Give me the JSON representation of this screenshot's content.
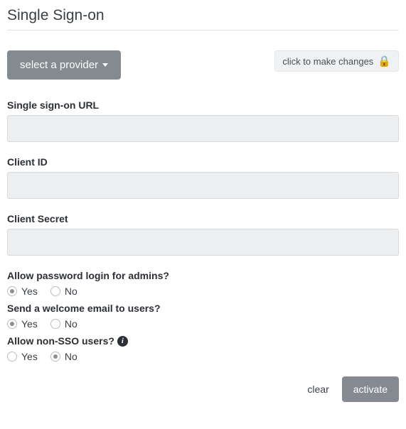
{
  "title": "Single Sign-on",
  "provider_button": "select a provider",
  "lock_button": "click to make changes",
  "fields": {
    "sso_url": {
      "label": "Single sign-on URL",
      "value": ""
    },
    "client_id": {
      "label": "Client ID",
      "value": ""
    },
    "client_secret": {
      "label": "Client Secret",
      "value": ""
    }
  },
  "radios": {
    "admin_password": {
      "label": "Allow password login for admins?",
      "yes": "Yes",
      "no": "No",
      "selected": "yes"
    },
    "welcome_email": {
      "label": "Send a welcome email to users?",
      "yes": "Yes",
      "no": "No",
      "selected": "yes"
    },
    "non_sso": {
      "label": "Allow non-SSO users?",
      "yes": "Yes",
      "no": "No",
      "selected": "no"
    }
  },
  "footer": {
    "clear": "clear",
    "activate": "activate"
  }
}
